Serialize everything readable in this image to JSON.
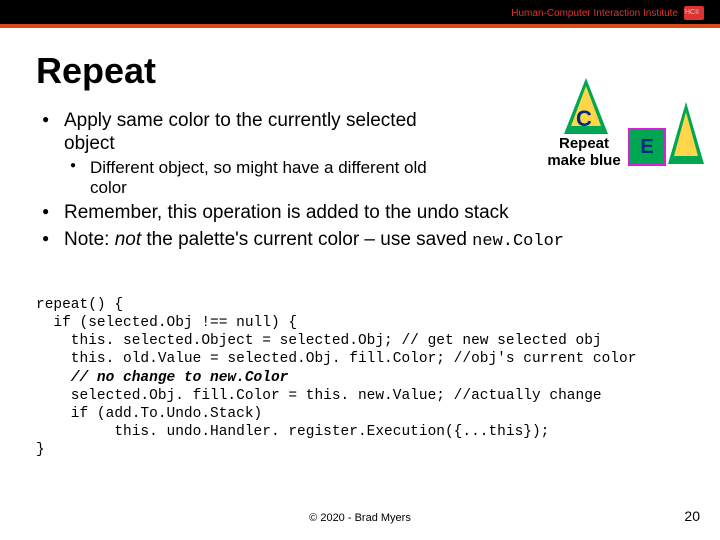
{
  "header": {
    "institute": "Human-Computer Interaction Institute"
  },
  "title": "Repeat",
  "bullets": {
    "b1": "Apply same color to the currently selected object",
    "b1_sub": "Different object, so might have a different old color",
    "b2": "Remember, this operation is added to the undo stack",
    "b3_prefix": "Note: ",
    "b3_italic": "not ",
    "b3_rest": "the palette's current color – use saved ",
    "b3_code": "new.Color"
  },
  "illustration": {
    "letter_c": "C",
    "repeat_line1": "Repeat",
    "repeat_line2": "make blue",
    "letter_e": "E"
  },
  "code": {
    "l1": "repeat() {",
    "l2": "  if (selected.Obj !== null) {",
    "l3": "    this. selected.Object = selected.Obj; // get new selected obj",
    "l4": "    this. old.Value = selected.Obj. fill.Color; //obj's current color",
    "l5": "    // no change to new.Color",
    "l6": "    selected.Obj. fill.Color = this. new.Value; //actually change",
    "l7": "    if (add.To.Undo.Stack)",
    "l8": "         this. undo.Handler. register.Execution({...this});",
    "l9": "}"
  },
  "footer": {
    "copyright": "© 2020 - Brad Myers",
    "page": "20"
  }
}
